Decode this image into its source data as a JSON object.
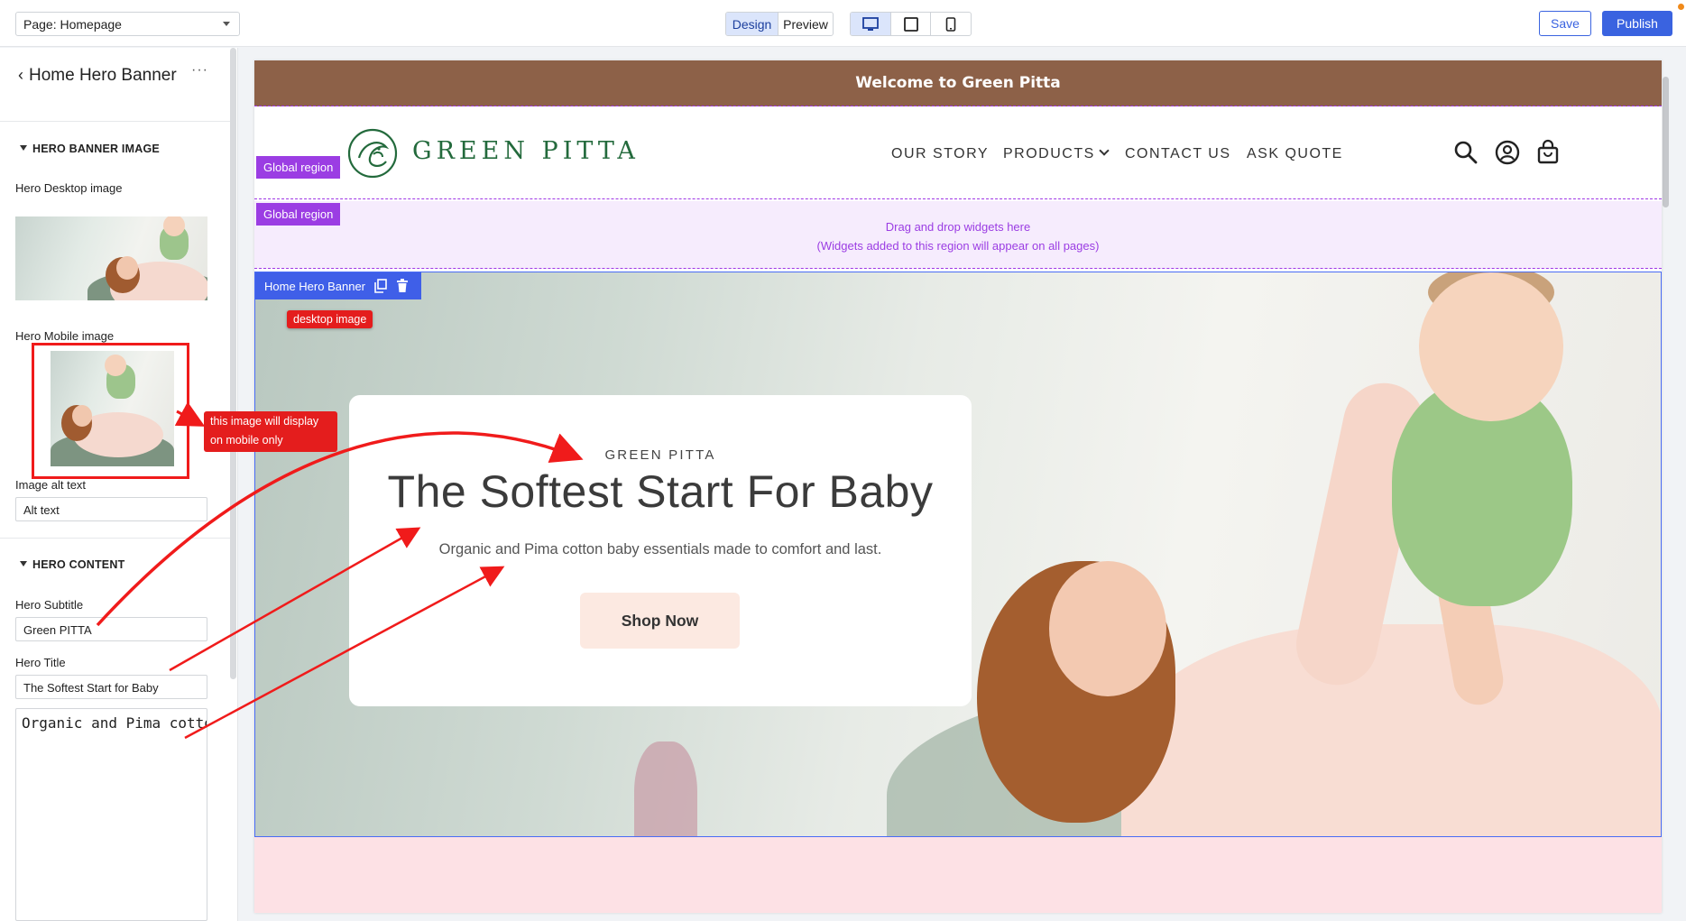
{
  "topbar": {
    "page_select": "Page: Homepage",
    "mode_design": "Design",
    "mode_preview": "Preview",
    "save": "Save",
    "publish": "Publish",
    "device_icons": [
      "desktop-icon",
      "tablet-icon",
      "mobile-icon"
    ],
    "active_device": "desktop"
  },
  "panel": {
    "title": "Home Hero Banner",
    "more": "···",
    "section_image": "HERO BANNER IMAGE",
    "desktop_image_label": "Hero Desktop image",
    "mobile_image_label": "Hero Mobile image",
    "alt_label": "Image alt text",
    "alt_value": "Alt text",
    "section_content": "HERO CONTENT",
    "subtitle_label": "Hero Subtitle",
    "subtitle_value": "Green PITTA",
    "title_label": "Hero Title",
    "title_value": "The Softest Start for Baby",
    "description_value": "Organic and Pima cotto"
  },
  "site": {
    "announcement": "Welcome to Green Pitta",
    "logo_text": "GREEN PITTA",
    "nav": [
      "OUR STORY",
      "PRODUCTS",
      "CONTACT US",
      "ASK QUOTE"
    ],
    "header_icons": [
      "search-icon",
      "account-icon",
      "cart-icon"
    ],
    "global_region_tag": "Global region",
    "drop_line1": "Drag and drop widgets here",
    "drop_line2": "(Widgets added to this region will appear on all pages)",
    "hero_widget_tag": "Home Hero Banner",
    "hero_subtitle": "GREEN PITTA",
    "hero_title": "The Softest Start For Baby",
    "hero_description": "Organic and Pima cotton baby essentials made to comfort and last.",
    "hero_button": "Shop Now"
  },
  "annotations": {
    "desktop_image": "desktop image",
    "mobile_note_line1": "this image will display",
    "mobile_note_line2": "on mobile only"
  },
  "colors": {
    "accent": "#3a63e0",
    "announcement_bg": "#8d6148",
    "global_region": "#9b3de3",
    "brand_green": "#236a3c",
    "button_bg": "#fce9e1",
    "annotation_red": "#e41d1d"
  }
}
